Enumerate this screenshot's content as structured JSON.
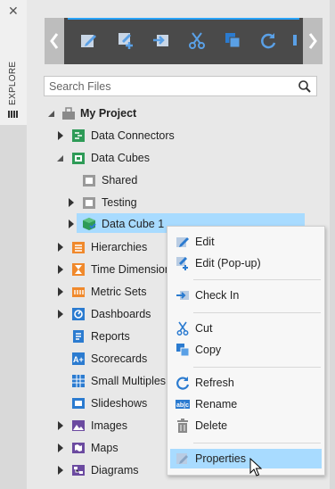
{
  "explore": {
    "close_glyph": "✕",
    "label": "EXPLORE"
  },
  "search": {
    "placeholder": "Search Files"
  },
  "tree": {
    "project": "My Project",
    "items": [
      {
        "label": "Data Connectors"
      },
      {
        "label": "Data Cubes"
      },
      {
        "label": "Shared"
      },
      {
        "label": "Testing"
      },
      {
        "label": "Data Cube 1"
      },
      {
        "label": "Hierarchies"
      },
      {
        "label": "Time Dimension"
      },
      {
        "label": "Metric Sets"
      },
      {
        "label": "Dashboards"
      },
      {
        "label": "Reports"
      },
      {
        "label": "Scorecards"
      },
      {
        "label": "Small Multiples"
      },
      {
        "label": "Slideshows"
      },
      {
        "label": "Images"
      },
      {
        "label": "Maps"
      },
      {
        "label": "Diagrams"
      }
    ]
  },
  "context_menu": {
    "edit": "Edit",
    "edit_popup": "Edit (Pop-up)",
    "check_in": "Check In",
    "cut": "Cut",
    "copy": "Copy",
    "refresh": "Refresh",
    "rename": "Rename",
    "delete": "Delete",
    "properties": "Properties"
  },
  "colors": {
    "accent": "#29a3ff",
    "selection": "#a8dbff",
    "toolbar": "#4a4a4a",
    "icon_blue": "#2b7bd0",
    "icon_green": "#2e9b57",
    "icon_orange": "#f0892c"
  }
}
